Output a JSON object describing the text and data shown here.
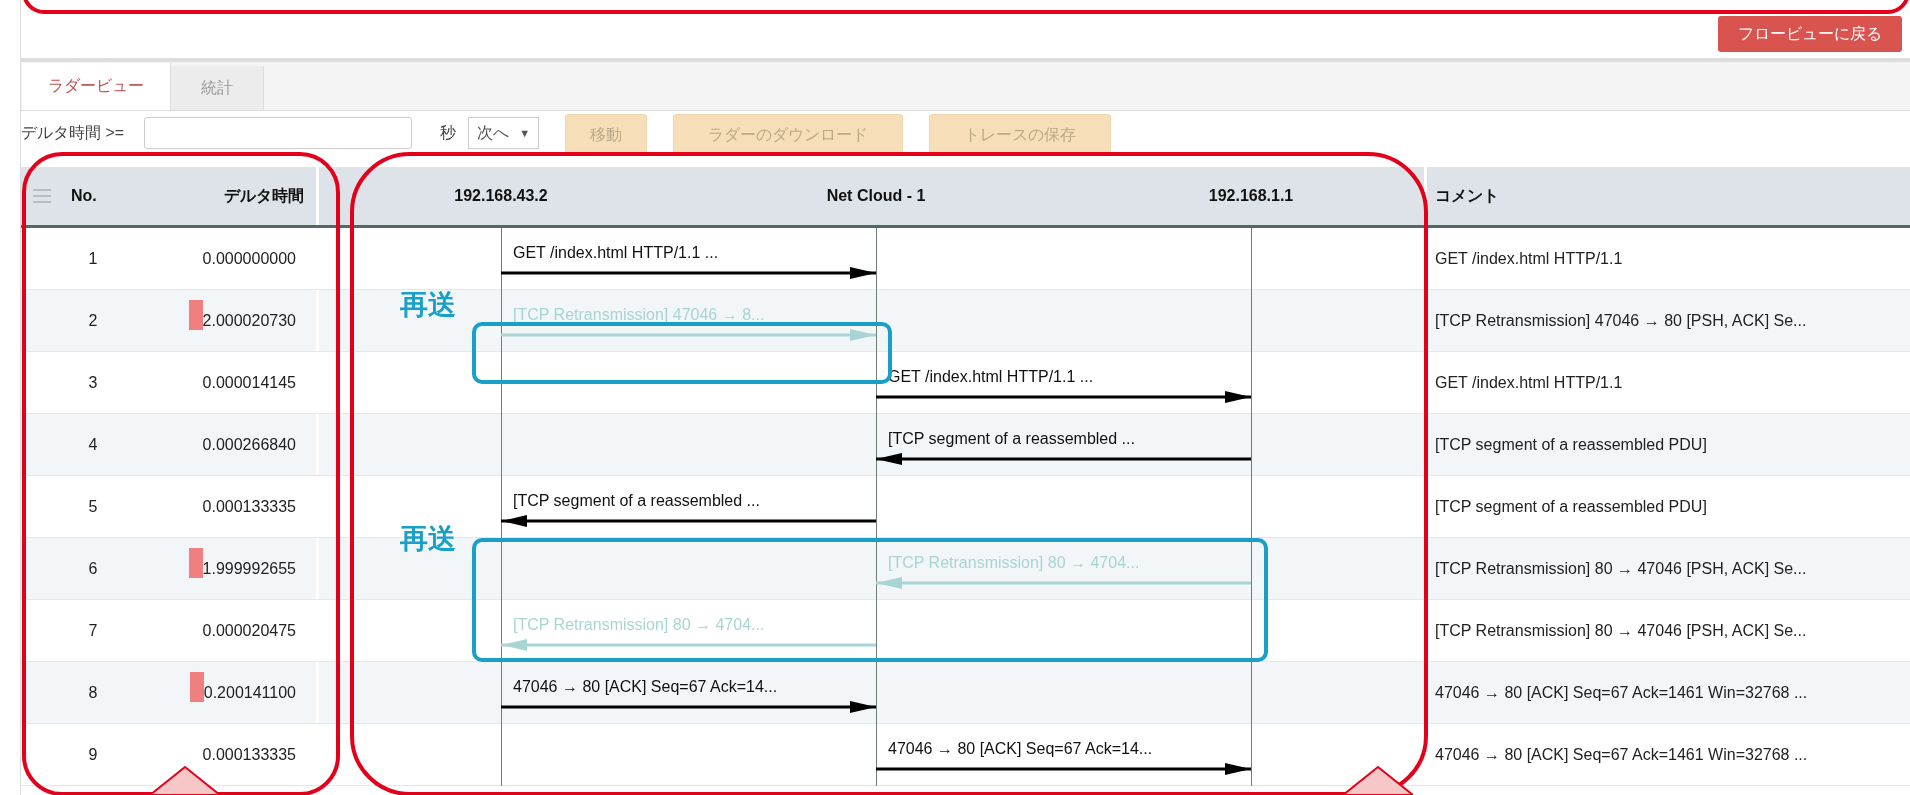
{
  "back_button": "フロービューに戻る",
  "tabs": [
    {
      "label": "ラダービュー",
      "selected": true
    },
    {
      "label": "統計",
      "selected": false
    }
  ],
  "toolbar": {
    "delta_label": "デルタ時間 >=",
    "unit": "秒",
    "direction_select": "次へ",
    "select_caret": "▼",
    "buttons": [
      {
        "label": "移動",
        "disabled": true
      },
      {
        "label": "ラダーのダウンロード",
        "disabled": true
      },
      {
        "label": "トレースの保存",
        "disabled": true
      }
    ]
  },
  "table": {
    "no_header": "No.",
    "delta_header": "デルタ時間",
    "endpoints": [
      "192.168.43.2",
      "Net Cloud - 1",
      "192.168.1.1"
    ],
    "comment_header": "コメント",
    "rows": [
      {
        "no": "1",
        "delta": "0.000000000",
        "flagged": false,
        "message": {
          "label": "GET /index.html HTTP/1.1 ...",
          "right_half": false,
          "points_right": true,
          "retransmission": false
        },
        "comment": "GET /index.html HTTP/1.1"
      },
      {
        "no": "2",
        "delta": "2.000020730",
        "flagged": true,
        "message": {
          "label": "[TCP Retransmission] 47046 → 8...",
          "right_half": false,
          "points_right": true,
          "retransmission": true
        },
        "comment": "[TCP Retransmission] 47046 → 80 [PSH, ACK] Se..."
      },
      {
        "no": "3",
        "delta": "0.000014145",
        "flagged": false,
        "message": {
          "label": "GET /index.html HTTP/1.1 ...",
          "right_half": true,
          "points_right": true,
          "retransmission": false
        },
        "comment": "GET /index.html HTTP/1.1"
      },
      {
        "no": "4",
        "delta": "0.000266840",
        "flagged": false,
        "message": {
          "label": "[TCP segment of a reassembled ...",
          "right_half": true,
          "points_right": false,
          "retransmission": false
        },
        "comment": "[TCP segment of a reassembled PDU]"
      },
      {
        "no": "5",
        "delta": "0.000133335",
        "flagged": false,
        "message": {
          "label": "[TCP segment of a reassembled ...",
          "right_half": false,
          "points_right": false,
          "retransmission": false
        },
        "comment": "[TCP segment of a reassembled PDU]"
      },
      {
        "no": "6",
        "delta": "1.999992655",
        "flagged": true,
        "message": {
          "label": "[TCP Retransmission] 80 → 4704...",
          "right_half": true,
          "points_right": false,
          "retransmission": true
        },
        "comment": "[TCP Retransmission] 80 → 47046 [PSH, ACK] Se..."
      },
      {
        "no": "7",
        "delta": "0.000020475",
        "flagged": false,
        "message": {
          "label": "[TCP Retransmission] 80 → 4704...",
          "right_half": false,
          "points_right": false,
          "retransmission": true
        },
        "comment": "[TCP Retransmission] 80 → 47046 [PSH, ACK] Se..."
      },
      {
        "no": "8",
        "delta": "0.200141100",
        "flagged": true,
        "message": {
          "label": "47046 → 80 [ACK] Seq=67 Ack=14...",
          "right_half": false,
          "points_right": true,
          "retransmission": false
        },
        "comment": "47046 → 80 [ACK] Seq=67 Ack=1461 Win=32768 ..."
      },
      {
        "no": "9",
        "delta": "0.000133335",
        "flagged": false,
        "message": {
          "label": "47046 → 80 [ACK] Seq=67 Ack=14...",
          "right_half": true,
          "points_right": true,
          "retransmission": false
        },
        "comment": "47046 → 80 [ACK] Seq=67 Ack=1461 Win=32768 ..."
      }
    ]
  },
  "annotations": [
    {
      "kind": "banner-frame"
    },
    {
      "kind": "panel-frame"
    },
    {
      "kind": "panel-frame"
    },
    {
      "kind": "callout",
      "label": "再送"
    },
    {
      "kind": "callout",
      "label": "再送"
    }
  ]
}
